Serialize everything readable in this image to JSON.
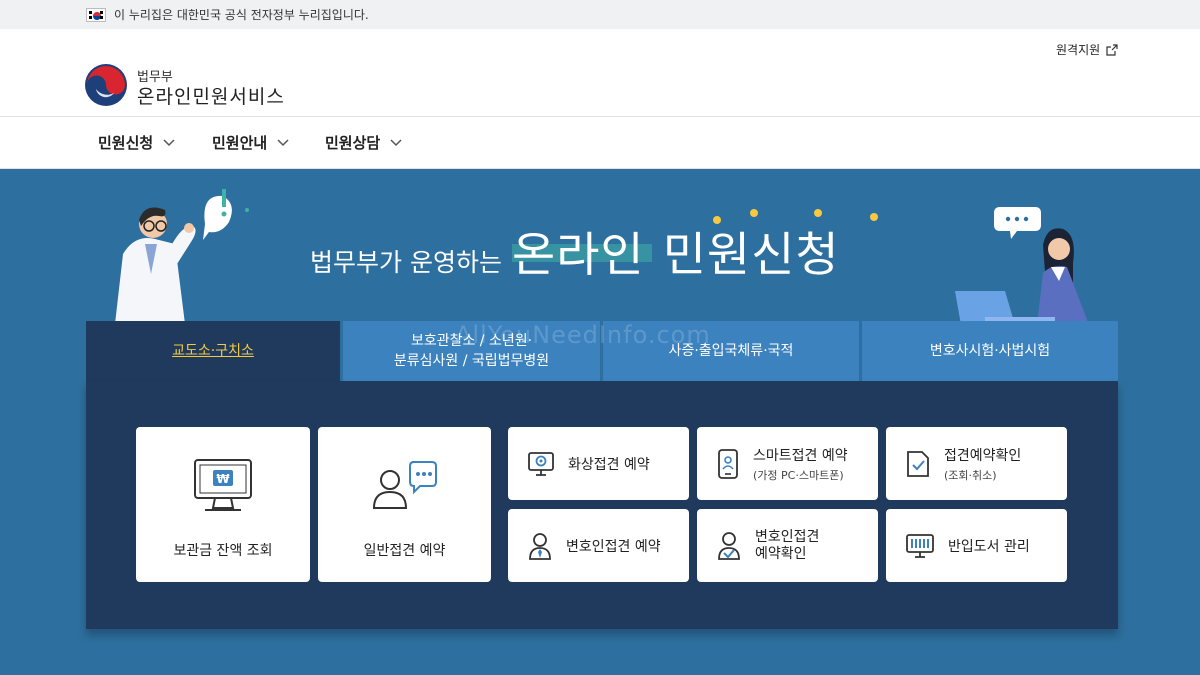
{
  "gov_banner": {
    "text": "이 누리집은 대한민국 공식 전자정부 누리집입니다."
  },
  "header": {
    "logo_sub": "법무부",
    "logo_main": "온라인민원서비스",
    "remote_support": "원격지원"
  },
  "gnb": {
    "items": [
      {
        "label": "민원신청"
      },
      {
        "label": "민원안내"
      },
      {
        "label": "민원상담"
      }
    ]
  },
  "hero": {
    "title_prefix": "법무부가 운영하는",
    "title_highlight": "온라인",
    "title_rest": "민원신청",
    "watermark": "AllYouNeedInfo.com"
  },
  "tabs": [
    {
      "label": "교도소·구치소",
      "active": true
    },
    {
      "line1": "보호관찰소 / 소년원·",
      "line2": "분류심사원 / 국립법무병원"
    },
    {
      "label": "사증·출입국체류·국적"
    },
    {
      "label": "변호사시험·사법시험"
    }
  ],
  "cards": {
    "balance": {
      "label": "보관금 잔액 조회"
    },
    "general_visit": {
      "label": "일반접견 예약"
    },
    "video_visit": {
      "label": "화상접견 예약"
    },
    "smart_visit": {
      "label": "스마트접견 예약",
      "sub": "(가정 PC·스마트폰)"
    },
    "visit_check": {
      "label": "접견예약확인",
      "sub": "(조회·취소)"
    },
    "lawyer_visit": {
      "label": "변호인접견 예약"
    },
    "lawyer_check": {
      "line1": "변호인접견",
      "line2": "예약확인"
    },
    "books": {
      "label": "반입도서 관리"
    }
  },
  "colors": {
    "hero_bg": "#2d6f9e",
    "tab_bg": "#3b82bf",
    "panel_bg": "#1f3a5c",
    "active_tab_text": "#f6c940",
    "highlight": "#3fb1a6"
  }
}
